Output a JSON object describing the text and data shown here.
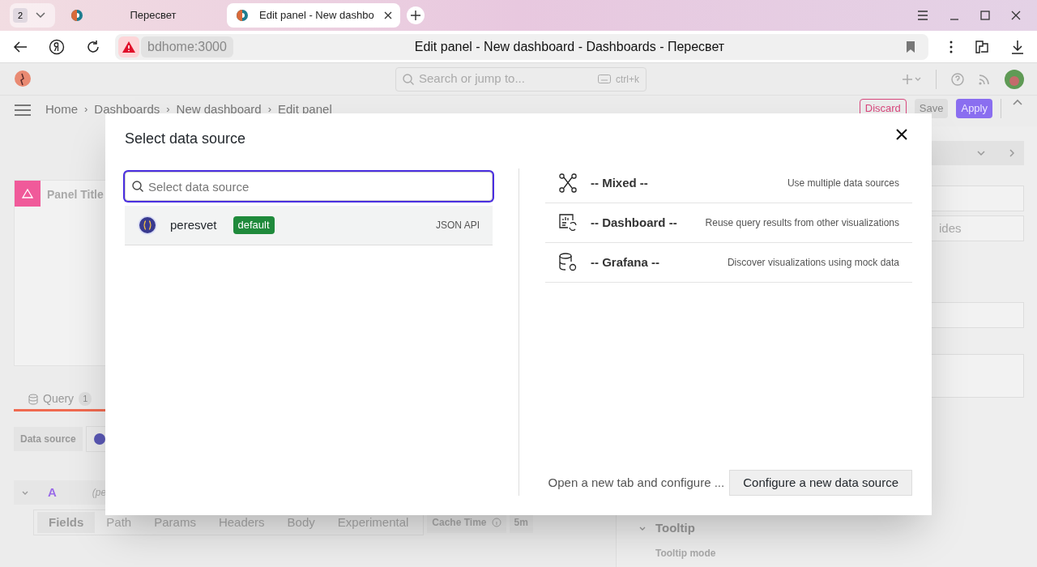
{
  "browser": {
    "tab_count": "2",
    "tabs": [
      {
        "title": "Пересвет",
        "selected": false
      },
      {
        "title": "Edit panel - New dashbo",
        "selected": true
      }
    ],
    "address": "bdhome:3000",
    "page_title": "Edit panel - New dashboard - Dashboards - Пересвет"
  },
  "topbar": {
    "search": {
      "placeholder": "Search or jump to...",
      "shortcut": "ctrl+k"
    }
  },
  "breadcrumbs": [
    "Home",
    "Dashboards",
    "New dashboard",
    "Edit panel"
  ],
  "breadcrumb_separator": "›",
  "actions": [
    {
      "label": "Discard",
      "kind": "danger"
    },
    {
      "label": "Save",
      "kind": "secondary"
    },
    {
      "label": "Apply",
      "kind": "primary"
    }
  ],
  "panel": {
    "title": "Panel Title"
  },
  "query_tab": {
    "label": "Query",
    "count": "1"
  },
  "data_source_label": "Data source",
  "query": {
    "ref": "A",
    "source": "(pe"
  },
  "query_tabs": [
    {
      "label": "Fields",
      "selected": true
    },
    {
      "label": "Path",
      "selected": false
    },
    {
      "label": "Params",
      "selected": false
    },
    {
      "label": "Headers",
      "selected": false
    },
    {
      "label": "Body",
      "selected": false
    },
    {
      "label": "Experimental",
      "selected": false
    }
  ],
  "cache_time": {
    "label": "Cache Time",
    "value": "5m"
  },
  "options": {
    "cut_field": "ides",
    "section": "Tooltip",
    "field_label": "Tooltip mode"
  },
  "modal": {
    "title": "Select data source",
    "search": {
      "placeholder": "Select data source"
    },
    "sources": [
      {
        "name": "peresvet",
        "badge": "default",
        "type": "JSON API",
        "selected": true
      }
    ],
    "builtins": [
      {
        "kind": "mixed",
        "name": "-- Mixed --",
        "description": "Use multiple data sources"
      },
      {
        "kind": "dashboard",
        "name": "-- Dashboard --",
        "description": "Reuse query results from other visualizations"
      },
      {
        "kind": "grafana",
        "name": "-- Grafana --",
        "description": "Discover visualizations using mock data"
      }
    ],
    "footer_text": "Open a new tab and configure ...",
    "configure_button": "Configure a new data source"
  }
}
